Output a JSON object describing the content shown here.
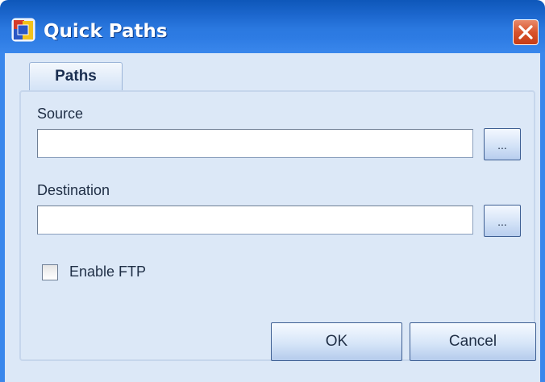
{
  "window": {
    "title": "Quick Paths",
    "titlebar_color": "#2d7be3",
    "close_button_color": "#d8532c",
    "app_icon": "app-icon",
    "close_icon": "close-icon"
  },
  "tabs": [
    {
      "label": "Paths",
      "selected": true
    }
  ],
  "source": {
    "label": "Source",
    "value": "",
    "browse_label": "..."
  },
  "destination": {
    "label": "Destination",
    "value": "",
    "browse_label": "..."
  },
  "ftp": {
    "label": "Enable FTP",
    "checked": false
  },
  "buttons": {
    "ok": "OK",
    "cancel": "Cancel"
  }
}
